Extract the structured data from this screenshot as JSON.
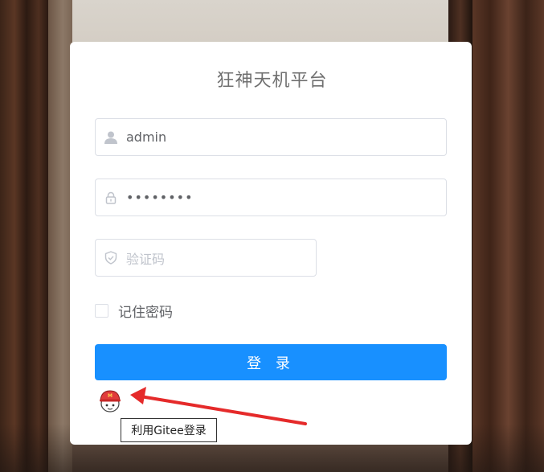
{
  "title": "狂神天机平台",
  "username": {
    "value": "admin",
    "icon": "user-icon"
  },
  "password": {
    "masked_value": "••••••••",
    "icon": "lock-icon"
  },
  "captcha": {
    "placeholder": "验证码",
    "icon": "shield-icon"
  },
  "remember": {
    "label": "记住密码",
    "checked": false
  },
  "login_button": {
    "label": "登 录",
    "color": "#1890ff"
  },
  "gitee": {
    "icon": "gitee-avatar-icon",
    "tooltip": "利用Gitee登录"
  },
  "annotation": {
    "color": "#e52a2a"
  }
}
